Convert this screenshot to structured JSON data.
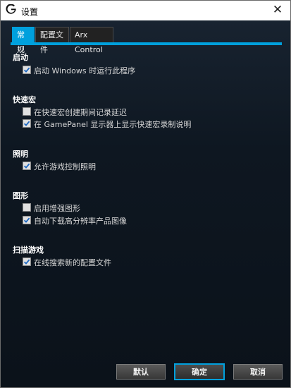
{
  "window": {
    "title": "设置",
    "logo_icon": "logitech-g-logo",
    "close_label": "✕"
  },
  "tabs": [
    {
      "label": "常规",
      "active": true
    },
    {
      "label": "配置文件",
      "active": false
    },
    {
      "label": "Arx Control",
      "active": false
    }
  ],
  "sections": {
    "startup": {
      "title": "启动",
      "options": [
        {
          "label": "启动 Windows 时运行此程序",
          "checked": true
        }
      ]
    },
    "macros": {
      "title": "快速宏",
      "options": [
        {
          "label": "在快速宏创建期间记录延迟",
          "checked": false
        },
        {
          "label": "在 GamePanel 显示器上显示快速宏录制说明",
          "checked": true
        }
      ]
    },
    "lighting": {
      "title": "照明",
      "options": [
        {
          "label": "允许游戏控制照明",
          "checked": true
        }
      ]
    },
    "graphics": {
      "title": "图形",
      "options": [
        {
          "label": "启用增强图形",
          "checked": false
        },
        {
          "label": "自动下载高分辨率产品图像",
          "checked": true
        }
      ]
    },
    "scan": {
      "title": "扫描游戏",
      "options": [
        {
          "label": "在线搜索新的配置文件",
          "checked": true
        }
      ]
    }
  },
  "buttons": {
    "default_label": "默认",
    "ok_label": "确定",
    "cancel_label": "取消"
  },
  "colors": {
    "accent": "#00a0dd",
    "background": "#0e1721"
  }
}
